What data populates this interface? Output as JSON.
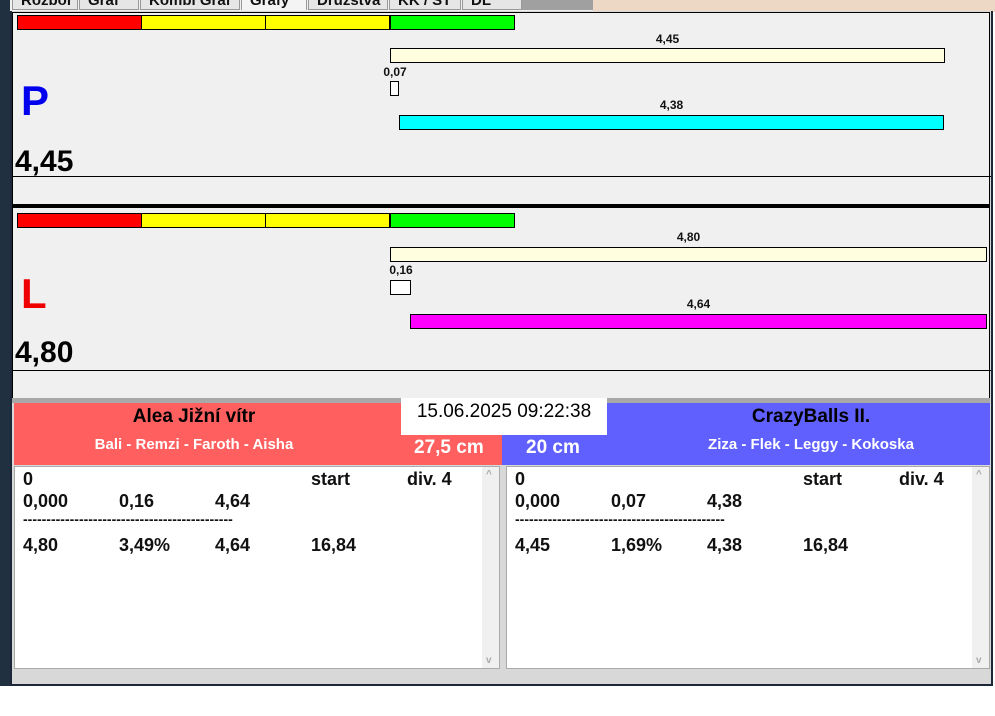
{
  "tabs": [
    "Rozbor",
    "Graf",
    "Kombi Graf",
    "Grafy",
    "Družstva",
    "KK / ST",
    "DL"
  ],
  "colors": {
    "red": "#ff0000",
    "yellow": "#ffff00",
    "green": "#00ff00",
    "cream": "#ffffe0",
    "cyan": "#00ffff",
    "magenta": "#ff00ff",
    "team_left": "#ff5f5f",
    "team_right": "#6060ff"
  },
  "lane_p": {
    "letter": "P",
    "total": "4,45",
    "bar_top": "4,45",
    "bar_small": "0,07",
    "bar_bottom": "4,38"
  },
  "lane_l": {
    "letter": "L",
    "total": "4,80",
    "bar_top": "4,80",
    "bar_small": "0,16",
    "bar_bottom": "4,64"
  },
  "datetime": "15.06.2025 09:22:38",
  "team_left": {
    "name": "Alea Jižní vítr",
    "players": "Bali - Remzi - Faroth - Aisha",
    "distance": "27,5 cm",
    "rows": [
      [
        "0",
        "",
        "",
        "start",
        "div. 4"
      ],
      [
        "0,000",
        "0,16",
        "4,64",
        "",
        ""
      ],
      [
        "---------------------------------------------",
        "",
        "",
        "",
        ""
      ],
      [
        "4,80",
        "3,49%",
        "4,64",
        "16,84",
        ""
      ]
    ]
  },
  "team_right": {
    "name": "CrazyBalls II.",
    "players": "Ziza - Flek - Leggy - Kokoska",
    "distance": "20 cm",
    "rows": [
      [
        "0",
        "",
        "",
        "start",
        "div. 4"
      ],
      [
        "0,000",
        "0,07",
        "4,38",
        "",
        ""
      ],
      [
        "---------------------------------------------",
        "",
        "",
        "",
        ""
      ],
      [
        "4,45",
        "1,69%",
        "4,38",
        "16,84",
        ""
      ]
    ]
  },
  "scroll_up": "^",
  "scroll_down": "v"
}
